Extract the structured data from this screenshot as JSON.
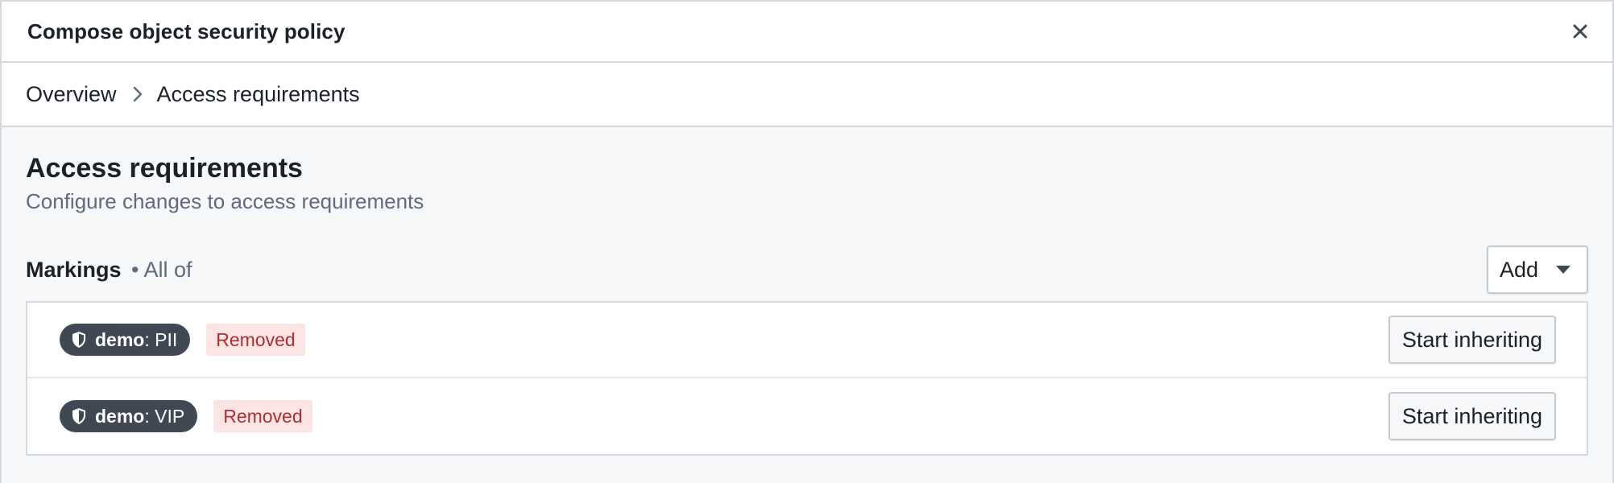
{
  "dialog": {
    "title": "Compose object security policy",
    "close_icon": "close-icon"
  },
  "breadcrumb": {
    "items": [
      "Overview",
      "Access requirements"
    ],
    "separator_icon": "chevron-right-icon"
  },
  "section": {
    "title": "Access requirements",
    "subtitle": "Configure changes to access requirements"
  },
  "markings": {
    "label": "Markings",
    "qualifier": "• All of",
    "add_label": "Add",
    "add_icon": "caret-down-icon",
    "rows": [
      {
        "namespace": "demo",
        "name": ": PII",
        "status": "Removed",
        "action": "Start inheriting",
        "icon": "shield-icon"
      },
      {
        "namespace": "demo",
        "name": ": VIP",
        "status": "Removed",
        "action": "Start inheriting",
        "icon": "shield-icon"
      }
    ]
  },
  "colors": {
    "tag_bg": "#404854",
    "removed_bg": "#fbe4e4",
    "removed_text": "#ac2f33",
    "body_bg": "#f6f7f9"
  }
}
